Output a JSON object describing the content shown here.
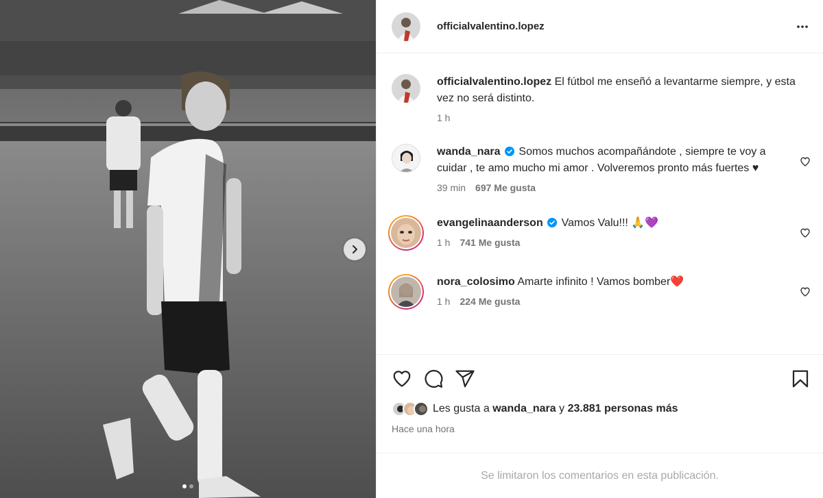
{
  "post": {
    "username": "officialvalentino.lopez",
    "caption": "El fútbol me enseñó a levantarme siempre, y esta vez no será distinto.",
    "caption_time": "1 h"
  },
  "comments": [
    {
      "username": "wanda_nara",
      "verified": true,
      "text": "Somos muchos acompañándote , siempre te voy a cuidar , te amo mucho mi amor . Volveremos pronto más fuertes ♥",
      "time": "39 min",
      "likes": "697 Me gusta"
    },
    {
      "username": "evangelinaanderson",
      "verified": true,
      "text": "Vamos Valu!!! 🙏💜",
      "time": "1 h",
      "likes": "741 Me gusta"
    },
    {
      "username": "nora_colosimo",
      "verified": false,
      "text": "Amarte infinito ! Vamos bomber❤️",
      "time": "1 h",
      "likes": "224 Me gusta"
    }
  ],
  "likes_summary": {
    "prefix": "Les gusta a",
    "user": "wanda_nara",
    "connector": "y",
    "count": "23.881 personas más"
  },
  "timestamp": "Hace una hora",
  "footer_note": "Se limitaron los comentarios en esta publicación.",
  "icons": {
    "more": "more-horizontal-icon",
    "like": "heart-icon",
    "comment": "comment-icon",
    "share": "share-icon",
    "save": "bookmark-icon",
    "next": "chevron-right-icon",
    "verified": "verified-badge-icon"
  },
  "colors": {
    "verified": "#0095f6",
    "text": "#262626",
    "secondary": "#737373",
    "muted": "#a8a8a8"
  },
  "carousel": {
    "slides": 2,
    "active_slide": 1
  }
}
